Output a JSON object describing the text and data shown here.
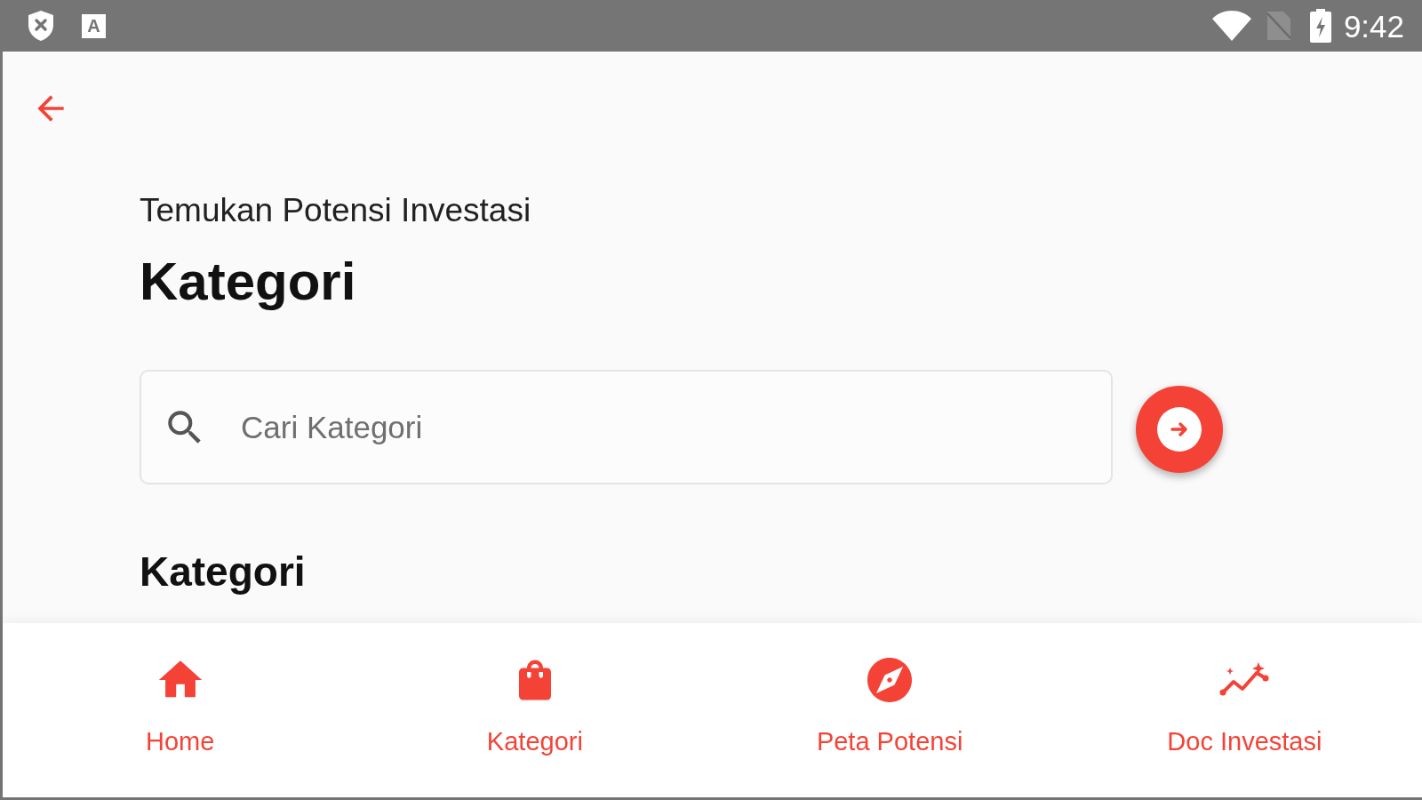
{
  "status_bar": {
    "notification_letter": "A",
    "time": "9:42"
  },
  "header": {
    "subtitle": "Temukan Potensi Investasi",
    "title": "Kategori"
  },
  "search": {
    "placeholder": "Cari Kategori"
  },
  "section": {
    "title": "Kategori"
  },
  "bottom_nav": [
    {
      "kind": "home",
      "label": "Home"
    },
    {
      "kind": "bag",
      "label": "Kategori"
    },
    {
      "kind": "compass",
      "label": "Peta Potensi"
    },
    {
      "kind": "graph",
      "label": "Doc Investasi"
    }
  ]
}
